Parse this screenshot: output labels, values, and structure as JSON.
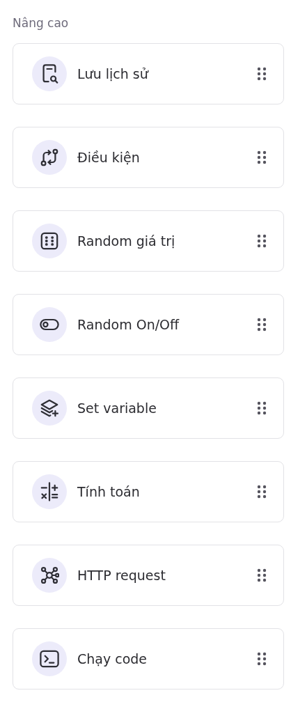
{
  "section_title": "Nâng cao",
  "items": [
    {
      "label": "Lưu lịch sử",
      "kind": "history"
    },
    {
      "label": "Điều kiện",
      "kind": "condition"
    },
    {
      "label": "Random giá trị",
      "kind": "dice"
    },
    {
      "label": "Random On/Off",
      "kind": "toggle"
    },
    {
      "label": "Set variable",
      "kind": "layers"
    },
    {
      "label": "Tính toán",
      "kind": "calc"
    },
    {
      "label": "HTTP request",
      "kind": "network"
    },
    {
      "label": "Chạy code",
      "kind": "terminal"
    }
  ]
}
